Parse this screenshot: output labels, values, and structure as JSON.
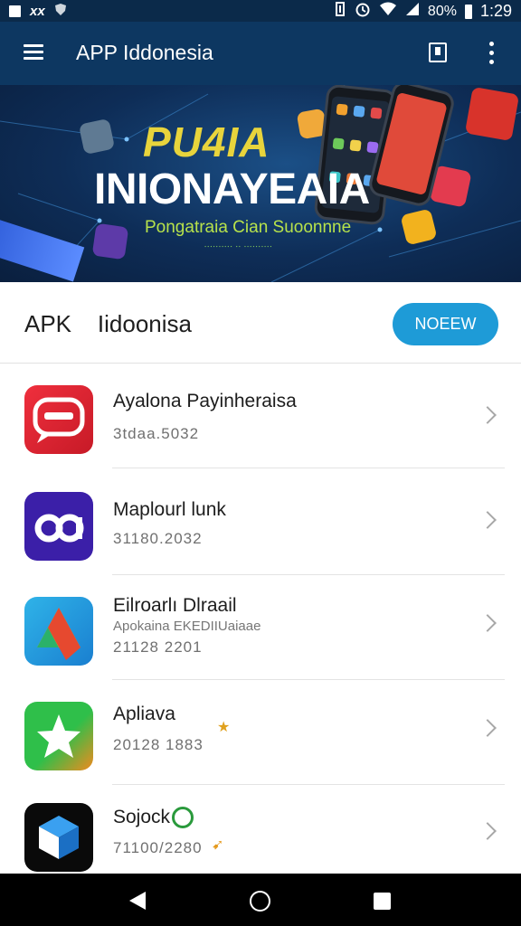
{
  "status_bar": {
    "left_text": "xx",
    "battery": "80%",
    "time": "1:29"
  },
  "app_bar": {
    "title": "APP Iddonesia"
  },
  "banner": {
    "headline_1": "PU4IA",
    "headline_2": "INIONAYEAIA",
    "subline": "Pongatraia Cian Suoonnne",
    "fine_print": "ꞏꞏꞏꞏꞏꞏꞏꞏꞏꞏ ꞏꞏ ꞏꞏꞏꞏꞏꞏꞏꞏꞏꞏ"
  },
  "section": {
    "title": "APK    Iidoonisa",
    "button_label": "NOEEW"
  },
  "apps": [
    {
      "name": "Ayalona Payinheraisa",
      "meta": "",
      "size": "3tdaa.5032"
    },
    {
      "name": "Maplourl lunk",
      "meta": "",
      "size": "31180.2032"
    },
    {
      "name": "Eilroarlı Dlraail",
      "meta": "Apokaina EKEDIIUaiaae",
      "size": "21128 2201"
    },
    {
      "name": "Apliava",
      "meta": "",
      "size": "20128 1883"
    },
    {
      "name": "Sojock",
      "meta": "",
      "size": "71100/2280"
    }
  ],
  "icons": {
    "status_left": [
      "image-icon",
      "whatsapp-icon",
      "shield-icon"
    ],
    "status_right": [
      "nfc-icon",
      "alarm-icon",
      "wifi-icon",
      "signal-icon"
    ],
    "app_bar": [
      "menu-icon",
      "bookmark-icon",
      "more-vert-icon"
    ],
    "nav": [
      "back-icon",
      "home-icon",
      "recents-icon"
    ]
  },
  "colors": {
    "status_bar": "#0b2a4a",
    "app_bar": "#0d3761",
    "accent": "#1e9bd7",
    "headline_yellow": "#e8d43c",
    "subline_green": "#b7e24b"
  }
}
